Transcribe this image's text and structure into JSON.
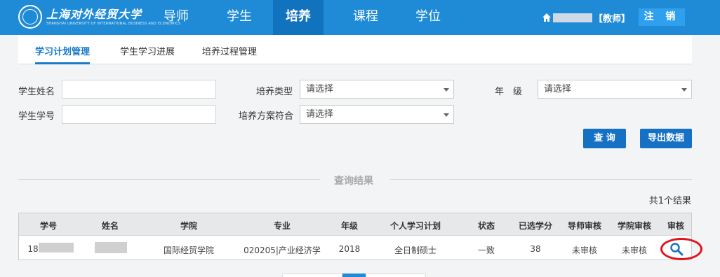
{
  "header": {
    "school_name_cn": "上海对外经贸大学",
    "school_name_en": "SHANGHAI UNIVERSITY OF INTERNATIONAL BUSINESS AND ECONOMICS",
    "nav": [
      "导师",
      "学生",
      "培养",
      "课程",
      "学位"
    ],
    "active_nav": "培养",
    "user_role": "【教师】",
    "logout_label": "注 销",
    "brand_color": "#1f8bd6"
  },
  "subtabs": [
    "学习计划管理",
    "学生学习进展",
    "培养过程管理"
  ],
  "filters": {
    "student_name_label": "学生姓名",
    "student_id_label": "学生学号",
    "training_type_label": "培养类型",
    "training_type_value": "请选择",
    "plan_match_label": "培养方案符合",
    "plan_match_value": "请选择",
    "grade_label": "年　级",
    "grade_value": "请选择",
    "query_label": "查 询",
    "export_label": "导出数据"
  },
  "results": {
    "title": "查询结果",
    "total": "共1个结果",
    "columns": [
      "学号",
      "姓名",
      "学院",
      "专业",
      "年级",
      "个人学习计划",
      "状态",
      "已选学分",
      "导师审核",
      "学院审核",
      "审核"
    ],
    "rows": [
      {
        "student_id_prefix": "18",
        "college": "国际经贸学院",
        "major": "020205|产业经济学",
        "grade": "2018",
        "plan": "全日制硕士",
        "status": "一致",
        "credits": "38",
        "advisor_review": "未审核",
        "college_review": "未审核"
      }
    ]
  },
  "icons": [
    "home-icon",
    "search-icon"
  ],
  "highlight_color": "#e0141b"
}
